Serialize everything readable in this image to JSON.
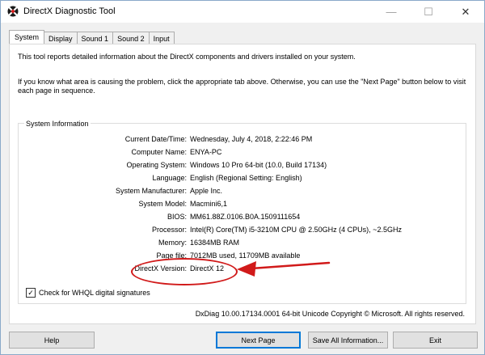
{
  "window": {
    "title": "DirectX Diagnostic Tool",
    "controls": {
      "minimize": "—",
      "maximize": "☐",
      "close": "✕"
    }
  },
  "tabs": [
    {
      "label": "System",
      "active": true
    },
    {
      "label": "Display",
      "active": false
    },
    {
      "label": "Sound 1",
      "active": false
    },
    {
      "label": "Sound 2",
      "active": false
    },
    {
      "label": "Input",
      "active": false
    }
  ],
  "intro": {
    "line1": "This tool reports detailed information about the DirectX components and drivers installed on your system.",
    "line2": "If you know what area is causing the problem, click the appropriate tab above.  Otherwise, you can use the \"Next Page\" button below to visit each page in sequence."
  },
  "system_info": {
    "title": "System Information",
    "rows": [
      {
        "label": "Current Date/Time:",
        "value": "Wednesday, July 4, 2018, 2:22:46 PM"
      },
      {
        "label": "Computer Name:",
        "value": "ENYA-PC"
      },
      {
        "label": "Operating System:",
        "value": "Windows 10 Pro 64-bit (10.0, Build 17134)"
      },
      {
        "label": "Language:",
        "value": "English (Regional Setting: English)"
      },
      {
        "label": "System Manufacturer:",
        "value": "Apple Inc."
      },
      {
        "label": "System Model:",
        "value": "Macmini6,1"
      },
      {
        "label": "BIOS:",
        "value": "MM61.88Z.0106.B0A.1509111654"
      },
      {
        "label": "Processor:",
        "value": "Intel(R) Core(TM) i5-3210M CPU @ 2.50GHz (4 CPUs), ~2.5GHz"
      },
      {
        "label": "Memory:",
        "value": "16384MB RAM"
      },
      {
        "label": "Page file:",
        "value": "7012MB used, 11709MB available"
      },
      {
        "label": "DirectX Version:",
        "value": "DirectX 12"
      }
    ]
  },
  "whql": {
    "label": "Check for WHQL digital signatures",
    "checked": true,
    "check_mark": "✓"
  },
  "footer": {
    "info": "DxDiag 10.00.17134.0001 64-bit Unicode  Copyright © Microsoft. All rights reserved."
  },
  "buttons": {
    "help": "Help",
    "next_page": "Next Page",
    "save_all": "Save All Information...",
    "exit": "Exit"
  },
  "colors": {
    "annotation": "#d11a1a",
    "focus_blue": "#0078d7"
  }
}
